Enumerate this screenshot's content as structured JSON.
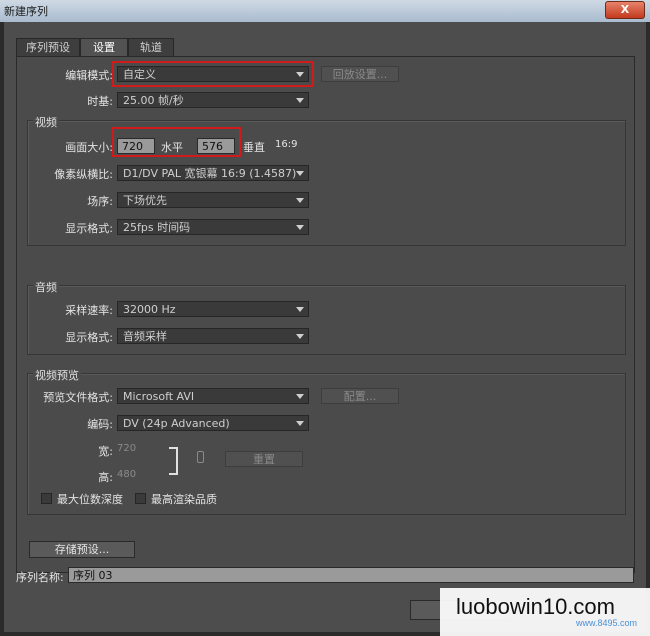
{
  "window": {
    "title": "新建序列",
    "close": "X"
  },
  "tabs": [
    "序列预设",
    "设置",
    "轨道"
  ],
  "editing": {
    "mode_label": "编辑模式:",
    "mode_value": "自定义",
    "playback_btn": "回放设置...",
    "timebase_label": "时基:",
    "timebase_value": "25.00 帧/秒"
  },
  "video": {
    "group_label": "视频",
    "frame_size_label": "画面大小:",
    "width": "720",
    "h_label": "水平",
    "height": "576",
    "v_label": "垂直",
    "aspect": "16:9",
    "par_label": "像素纵横比:",
    "par_value": "D1/DV PAL 宽银幕 16:9 (1.4587)",
    "fields_label": "场序:",
    "fields_value": "下场优先",
    "display_label": "显示格式:",
    "display_value": "25fps 时间码"
  },
  "audio": {
    "group_label": "音频",
    "rate_label": "采样速率:",
    "rate_value": "32000 Hz",
    "display_label": "显示格式:",
    "display_value": "音频采样"
  },
  "preview": {
    "group_label": "视频预览",
    "file_label": "预览文件格式:",
    "file_value": "Microsoft AVI",
    "config_btn": "配置...",
    "codec_label": "编码:",
    "codec_value": "DV (24p Advanced)",
    "width_label": "宽:",
    "width_value": "720",
    "height_label": "高:",
    "height_value": "480",
    "reset_btn": "重置",
    "max_depth": "最大位数深度",
    "max_quality": "最高渲染品质"
  },
  "save_preset_btn": "存储预设...",
  "sequence_name": {
    "label": "序列名称:",
    "value": "序列 03"
  },
  "watermark": {
    "text": "luobowin10.com",
    "sub": "www.8495.com"
  }
}
